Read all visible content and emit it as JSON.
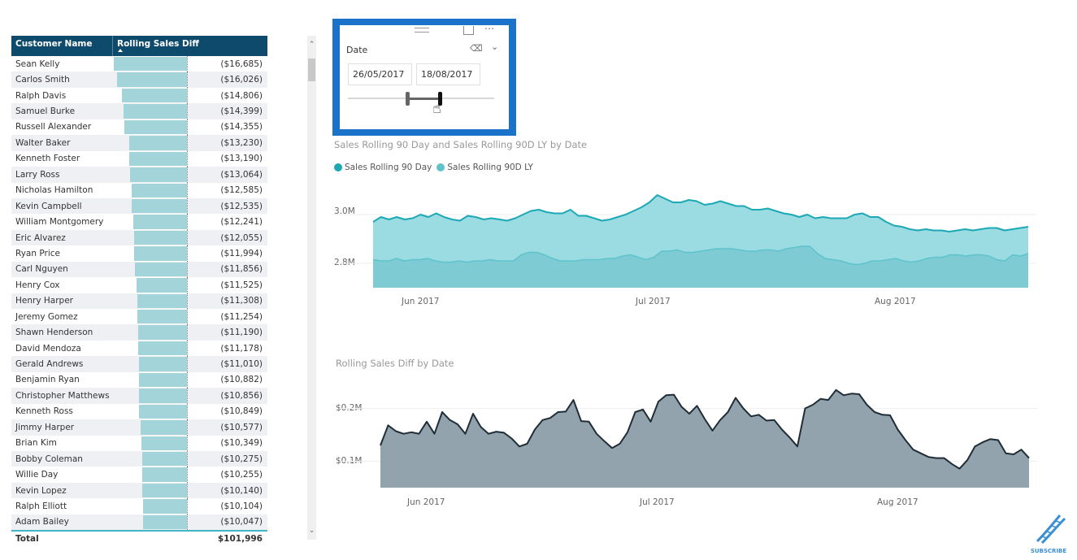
{
  "table": {
    "columns": [
      "Customer Name",
      "Rolling Sales Diff"
    ],
    "sort": "ascending",
    "rows": [
      {
        "name": "Sean Kelly",
        "value": "($16,685)",
        "amount": 16685
      },
      {
        "name": "Carlos Smith",
        "value": "($16,026)",
        "amount": 16026
      },
      {
        "name": "Ralph Davis",
        "value": "($14,806)",
        "amount": 14806
      },
      {
        "name": "Samuel Burke",
        "value": "($14,399)",
        "amount": 14399
      },
      {
        "name": "Russell Alexander",
        "value": "($14,355)",
        "amount": 14355
      },
      {
        "name": "Walter Baker",
        "value": "($13,230)",
        "amount": 13230
      },
      {
        "name": "Kenneth Foster",
        "value": "($13,190)",
        "amount": 13190
      },
      {
        "name": "Larry Ross",
        "value": "($13,064)",
        "amount": 13064
      },
      {
        "name": "Nicholas Hamilton",
        "value": "($12,585)",
        "amount": 12585
      },
      {
        "name": "Kevin Campbell",
        "value": "($12,535)",
        "amount": 12535
      },
      {
        "name": "William Montgomery",
        "value": "($12,241)",
        "amount": 12241
      },
      {
        "name": "Eric Alvarez",
        "value": "($12,055)",
        "amount": 12055
      },
      {
        "name": "Ryan Price",
        "value": "($11,994)",
        "amount": 11994
      },
      {
        "name": "Carl Nguyen",
        "value": "($11,856)",
        "amount": 11856
      },
      {
        "name": "Henry Cox",
        "value": "($11,525)",
        "amount": 11525
      },
      {
        "name": "Henry Harper",
        "value": "($11,308)",
        "amount": 11308
      },
      {
        "name": "Jeremy Gomez",
        "value": "($11,254)",
        "amount": 11254
      },
      {
        "name": "Shawn Henderson",
        "value": "($11,190)",
        "amount": 11190
      },
      {
        "name": "David Mendoza",
        "value": "($11,178)",
        "amount": 11178
      },
      {
        "name": "Gerald Andrews",
        "value": "($11,010)",
        "amount": 11010
      },
      {
        "name": "Benjamin Ryan",
        "value": "($10,882)",
        "amount": 10882
      },
      {
        "name": "Christopher Matthews",
        "value": "($10,856)",
        "amount": 10856
      },
      {
        "name": "Kenneth Ross",
        "value": "($10,849)",
        "amount": 10849
      },
      {
        "name": "Jimmy Harper",
        "value": "($10,577)",
        "amount": 10577
      },
      {
        "name": "Brian Kim",
        "value": "($10,349)",
        "amount": 10349
      },
      {
        "name": "Bobby Coleman",
        "value": "($10,275)",
        "amount": 10275
      },
      {
        "name": "Willie Day",
        "value": "($10,255)",
        "amount": 10255
      },
      {
        "name": "Kevin Lopez",
        "value": "($10,140)",
        "amount": 10140
      },
      {
        "name": "Ralph Elliott",
        "value": "($10,104)",
        "amount": 10104
      },
      {
        "name": "Adam Bailey",
        "value": "($10,047)",
        "amount": 10047
      }
    ],
    "total_label": "Total",
    "total_value": "$101,996",
    "bar_color": "#a3d4da"
  },
  "slicer": {
    "title": "Date",
    "start_date": "26/05/2017",
    "end_date": "18/08/2017",
    "range_start_fraction": 0.41,
    "range_end_fraction": 0.63,
    "icons": [
      "drag-handle-icon",
      "focus-mode-icon",
      "more-options-icon",
      "eraser-icon",
      "chevron-down-icon",
      "hand-cursor-icon"
    ]
  },
  "colors": {
    "selection_border": "#1a73c9",
    "header_bg": "#0d4a6b",
    "series_current": "#1ca8b4",
    "series_ly": "#5fc3cc",
    "area_current": "#9adce2",
    "area_ly": "#7ecbd4",
    "diff_line": "#1f2d36",
    "diff_area": "#93a3ad"
  },
  "chart_data": [
    {
      "type": "area",
      "title": "Sales Rolling 90 Day and Sales Rolling 90D LY by Date",
      "legend": [
        "Sales Rolling 90 Day",
        "Sales Rolling 90D LY"
      ],
      "legend_position": "top-left",
      "x_ticks": [
        "Jun 2017",
        "Jul 2017",
        "Aug 2017"
      ],
      "y_ticks": [
        "2.8M",
        "3.0M"
      ],
      "ylim": [
        2.7,
        3.12
      ],
      "grid": true,
      "x_range": [
        "26/05/2017",
        "18/08/2017"
      ],
      "series": [
        {
          "name": "Sales Rolling 90 Day",
          "values": [
            2.97,
            2.99,
            2.98,
            2.99,
            2.98,
            2.985,
            3.0,
            2.99,
            3.005,
            2.99,
            2.98,
            2.975,
            2.995,
            2.99,
            2.98,
            2.985,
            2.98,
            2.975,
            2.985,
            3.0,
            3.015,
            3.02,
            3.01,
            3.005,
            3.005,
            3.02,
            2.995,
            2.995,
            2.985,
            2.975,
            2.98,
            2.99,
            3.0,
            3.015,
            3.03,
            3.05,
            3.08,
            3.065,
            3.05,
            3.05,
            3.06,
            3.055,
            3.04,
            3.045,
            3.055,
            3.045,
            3.035,
            3.035,
            3.02,
            3.02,
            3.025,
            3.015,
            3.005,
            3.0,
            2.99,
            3.0,
            2.985,
            2.99,
            2.985,
            2.985,
            2.985,
            3.0,
            3.005,
            2.99,
            2.99,
            2.97,
            2.955,
            2.95,
            2.94,
            2.935,
            2.94,
            2.935,
            2.935,
            2.93,
            2.935,
            2.94,
            2.935,
            2.94,
            2.945,
            2.945,
            2.935,
            2.94,
            2.945,
            2.95
          ]
        },
        {
          "name": "Sales Rolling 90D LY",
          "values": [
            2.815,
            2.81,
            2.81,
            2.82,
            2.81,
            2.815,
            2.815,
            2.82,
            2.81,
            2.805,
            2.805,
            2.81,
            2.805,
            2.81,
            2.81,
            2.815,
            2.81,
            2.81,
            2.81,
            2.835,
            2.845,
            2.845,
            2.835,
            2.82,
            2.81,
            2.81,
            2.81,
            2.815,
            2.815,
            2.815,
            2.82,
            2.82,
            2.83,
            2.835,
            2.825,
            2.815,
            2.825,
            2.85,
            2.85,
            2.855,
            2.845,
            2.845,
            2.85,
            2.855,
            2.86,
            2.86,
            2.86,
            2.855,
            2.85,
            2.85,
            2.855,
            2.855,
            2.85,
            2.86,
            2.865,
            2.87,
            2.87,
            2.84,
            2.82,
            2.815,
            2.81,
            2.8,
            2.795,
            2.8,
            2.81,
            2.81,
            2.815,
            2.82,
            2.81,
            2.805,
            2.81,
            2.82,
            2.825,
            2.825,
            2.835,
            2.835,
            2.83,
            2.835,
            2.835,
            2.83,
            2.815,
            2.81,
            2.835,
            2.83,
            2.84
          ]
        }
      ]
    },
    {
      "type": "area",
      "title": "Rolling Sales Diff by Date",
      "x_ticks": [
        "Jun 2017",
        "Jul 2017",
        "Aug 2017"
      ],
      "y_ticks": [
        "$0.1M",
        "$0.2M"
      ],
      "ylim": [
        0.05,
        0.25
      ],
      "grid": true,
      "x_range": [
        "26/05/2017",
        "18/08/2017"
      ],
      "series": [
        {
          "name": "Rolling Sales Diff",
          "values": [
            0.13,
            0.168,
            0.157,
            0.152,
            0.155,
            0.152,
            0.175,
            0.152,
            0.193,
            0.178,
            0.17,
            0.152,
            0.19,
            0.165,
            0.152,
            0.156,
            0.154,
            0.143,
            0.128,
            0.133,
            0.16,
            0.178,
            0.182,
            0.193,
            0.194,
            0.216,
            0.176,
            0.175,
            0.152,
            0.138,
            0.125,
            0.133,
            0.155,
            0.193,
            0.198,
            0.175,
            0.213,
            0.225,
            0.226,
            0.203,
            0.19,
            0.205,
            0.18,
            0.158,
            0.178,
            0.193,
            0.22,
            0.2,
            0.185,
            0.188,
            0.177,
            0.178,
            0.16,
            0.145,
            0.128,
            0.2,
            0.207,
            0.218,
            0.216,
            0.235,
            0.225,
            0.228,
            0.227,
            0.207,
            0.193,
            0.188,
            0.187,
            0.16,
            0.14,
            0.122,
            0.115,
            0.108,
            0.106,
            0.106,
            0.095,
            0.086,
            0.102,
            0.128,
            0.136,
            0.142,
            0.14,
            0.115,
            0.113,
            0.122,
            0.106
          ]
        }
      ]
    }
  ],
  "scrollbar": {
    "position_fraction": 0.0
  },
  "branding": {
    "subscribe_label": "SUBSCRIBE"
  }
}
